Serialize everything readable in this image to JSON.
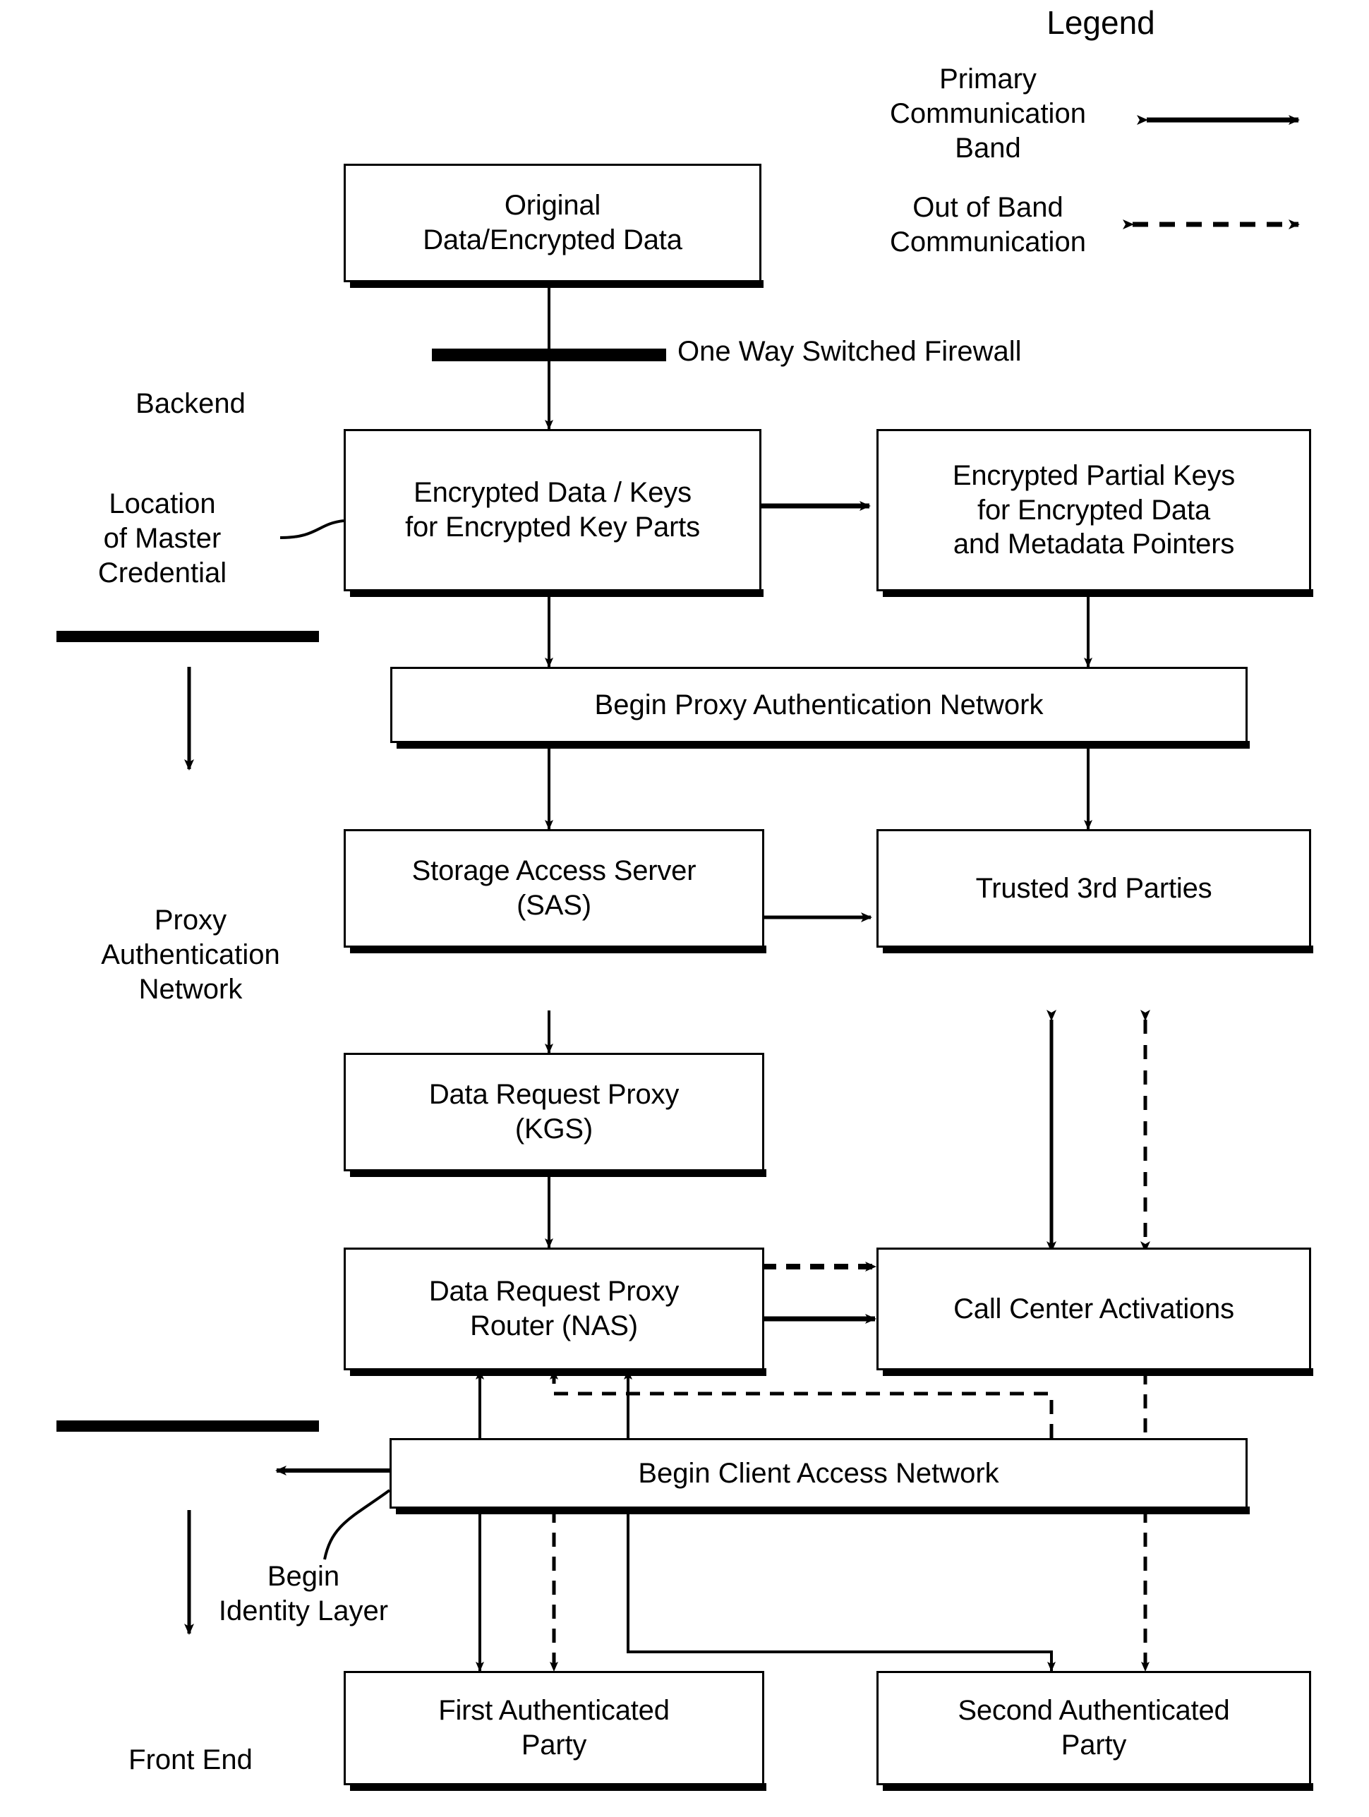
{
  "legend": {
    "title": "Legend",
    "items": [
      {
        "label": "Primary\nCommunication\nBand",
        "style": "solid-double-arrow"
      },
      {
        "label": "Out of Band\nCommunication",
        "style": "dashed-double-arrow"
      }
    ]
  },
  "side_labels": {
    "backend": "Backend",
    "location_of_master_credential": "Location\nof Master\nCredential",
    "proxy_authentication_network": "Proxy\nAuthentication\nNetwork",
    "begin_identity_layer": "Begin\nIdentity Layer",
    "front_end": "Front End"
  },
  "annotations": {
    "one_way_switched_firewall": "One Way Switched Firewall"
  },
  "nodes": {
    "original_data": "Original\nData/Encrypted Data",
    "encrypted_data_keys": "Encrypted Data / Keys\nfor Encrypted Key Parts",
    "encrypted_partial_keys": "Encrypted Partial Keys\nfor Encrypted Data\nand Metadata Pointers",
    "begin_proxy_auth_network": "Begin Proxy Authentication Network",
    "storage_access_server": "Storage Access Server\n(SAS)",
    "trusted_third_parties": "Trusted 3rd Parties",
    "data_request_proxy_kgs": "Data Request Proxy\n(KGS)",
    "data_request_proxy_router": "Data Request Proxy\nRouter (NAS)",
    "call_center_activations": "Call Center Activations",
    "begin_client_access_network": "Begin Client Access Network",
    "first_authenticated_party": "First Authenticated\nParty",
    "second_authenticated_party": "Second Authenticated\nParty"
  },
  "colors": {
    "ink": "#000000",
    "paper": "#ffffff"
  }
}
